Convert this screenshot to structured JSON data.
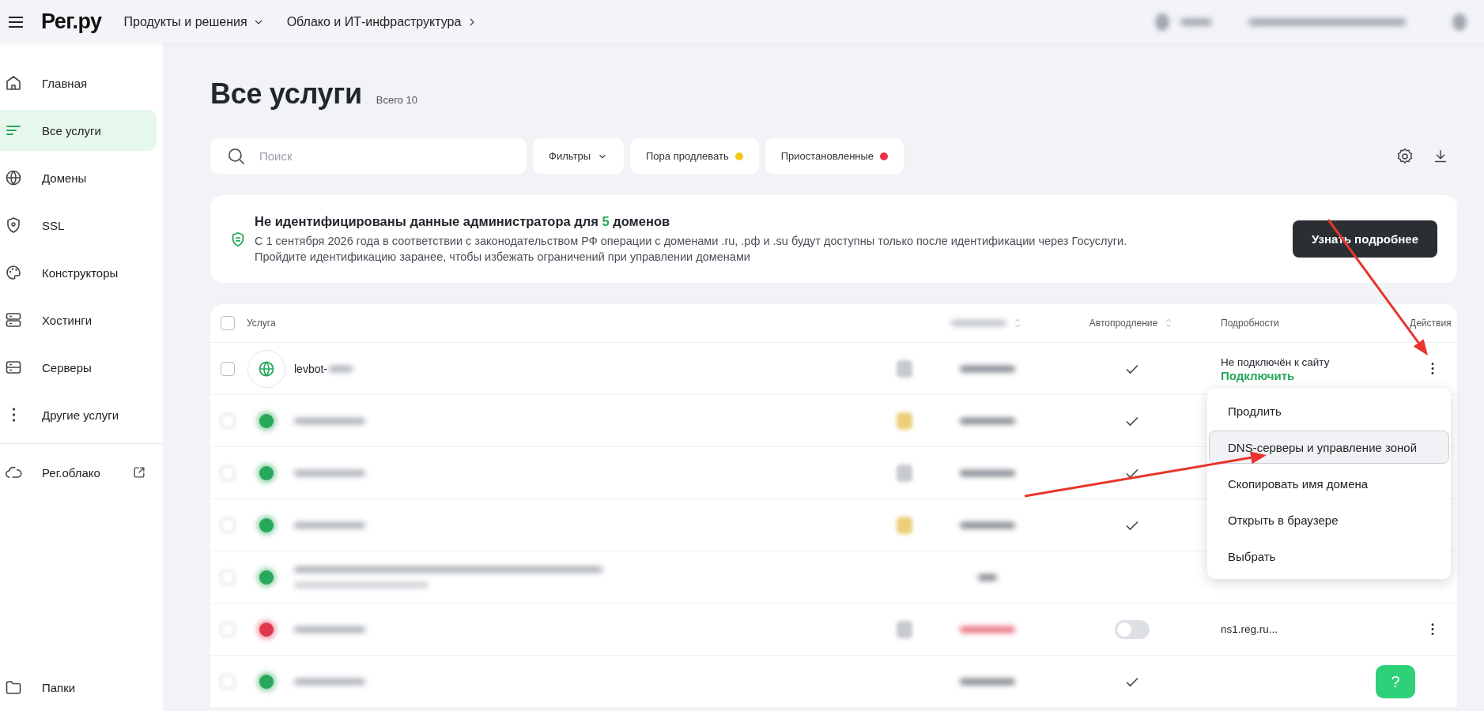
{
  "topbar": {
    "logo": "Рег.ру",
    "nav": [
      {
        "label": "Продукты и решения",
        "kind": "dropdown"
      },
      {
        "label": "Облако и ИТ-инфраструктура",
        "kind": "link"
      }
    ]
  },
  "sidebar": {
    "items": [
      {
        "label": "Главная",
        "selected": false
      },
      {
        "label": "Все услуги",
        "selected": true
      },
      {
        "label": "Домены",
        "selected": false
      },
      {
        "label": "SSL",
        "selected": false
      },
      {
        "label": "Конструкторы",
        "selected": false
      },
      {
        "label": "Хостинги",
        "selected": false
      },
      {
        "label": "Серверы",
        "selected": false
      },
      {
        "label": "Другие услуги",
        "selected": false
      }
    ],
    "external": {
      "label": "Рег.облако"
    },
    "bottom": {
      "label": "Папки"
    }
  },
  "page": {
    "title": "Все услуги",
    "count": "Всего 10"
  },
  "toolbar": {
    "search_placeholder": "Поиск",
    "filters": "Фильтры",
    "chips": [
      {
        "label": "Пора продлевать",
        "color": "#f5c518"
      },
      {
        "label": "Приостановленные",
        "color": "#f0314a"
      }
    ]
  },
  "banner": {
    "title_parts": [
      "Не идентифицированы данные администратора для ",
      "5",
      " доменов"
    ],
    "lines": [
      "С 1 сентября 2026 года в соответствии с законодательством РФ операции с доменами .ru, .рф и .su будут доступны только после идентификации через Госуслуги.",
      "Пройдите идентификацию заранее, чтобы избежать ограничений при управлении доменами"
    ],
    "button": "Узнать подробнее"
  },
  "table": {
    "select_all": {
      "checked": false
    },
    "columns": {
      "service": "Услуга",
      "autorenew": "Автопродление",
      "details": "Подробности",
      "actions": "Действия"
    },
    "rows": [
      {
        "checked": false,
        "color": "#27a85a",
        "name": "levbot-",
        "lock": true,
        "renew_soon": false,
        "suspended": false,
        "kind": "check",
        "details": [
          "Не подключён к сайту",
          "Подключить"
        ],
        "actions": true
      },
      {
        "checked": false,
        "color": "#27a85a",
        "lock": true,
        "renew_soon": true,
        "suspended": false,
        "kind": "check",
        "actions": false
      },
      {
        "checked": false,
        "color": "#27a85a",
        "lock": true,
        "renew_soon": false,
        "suspended": false,
        "kind": "check",
        "actions": false
      },
      {
        "checked": false,
        "color": "#27a85a",
        "lock": true,
        "renew_soon": true,
        "suspended": false,
        "kind": "check",
        "actions": false
      },
      {
        "checked": false,
        "color": "#27a85a",
        "subtitle": true,
        "lock": false,
        "suspended": false,
        "kind": "plain",
        "actions": false
      },
      {
        "checked": false,
        "color": "#e0394f",
        "lock": true,
        "renew_soon": false,
        "suspended": true,
        "kind": "toggle",
        "on": false,
        "details": [
          "ns1.reg.ru..."
        ],
        "actions": true
      },
      {
        "checked": false,
        "color": "#27a85a",
        "lock": false,
        "suspended": false,
        "kind": "check",
        "actions": false
      }
    ]
  },
  "menu": {
    "items": [
      {
        "label": "Продлить",
        "selected": false
      },
      {
        "label": "DNS-серверы и управление зоной",
        "selected": true
      },
      {
        "label": "Скопировать имя домена",
        "selected": false
      },
      {
        "label": "Открыть в браузере",
        "selected": false
      },
      {
        "label": "Выбрать",
        "selected": false
      }
    ]
  },
  "help": {
    "label": "?"
  },
  "annotations": [
    {
      "kind": "arrow"
    },
    {
      "kind": "arrow"
    }
  ]
}
